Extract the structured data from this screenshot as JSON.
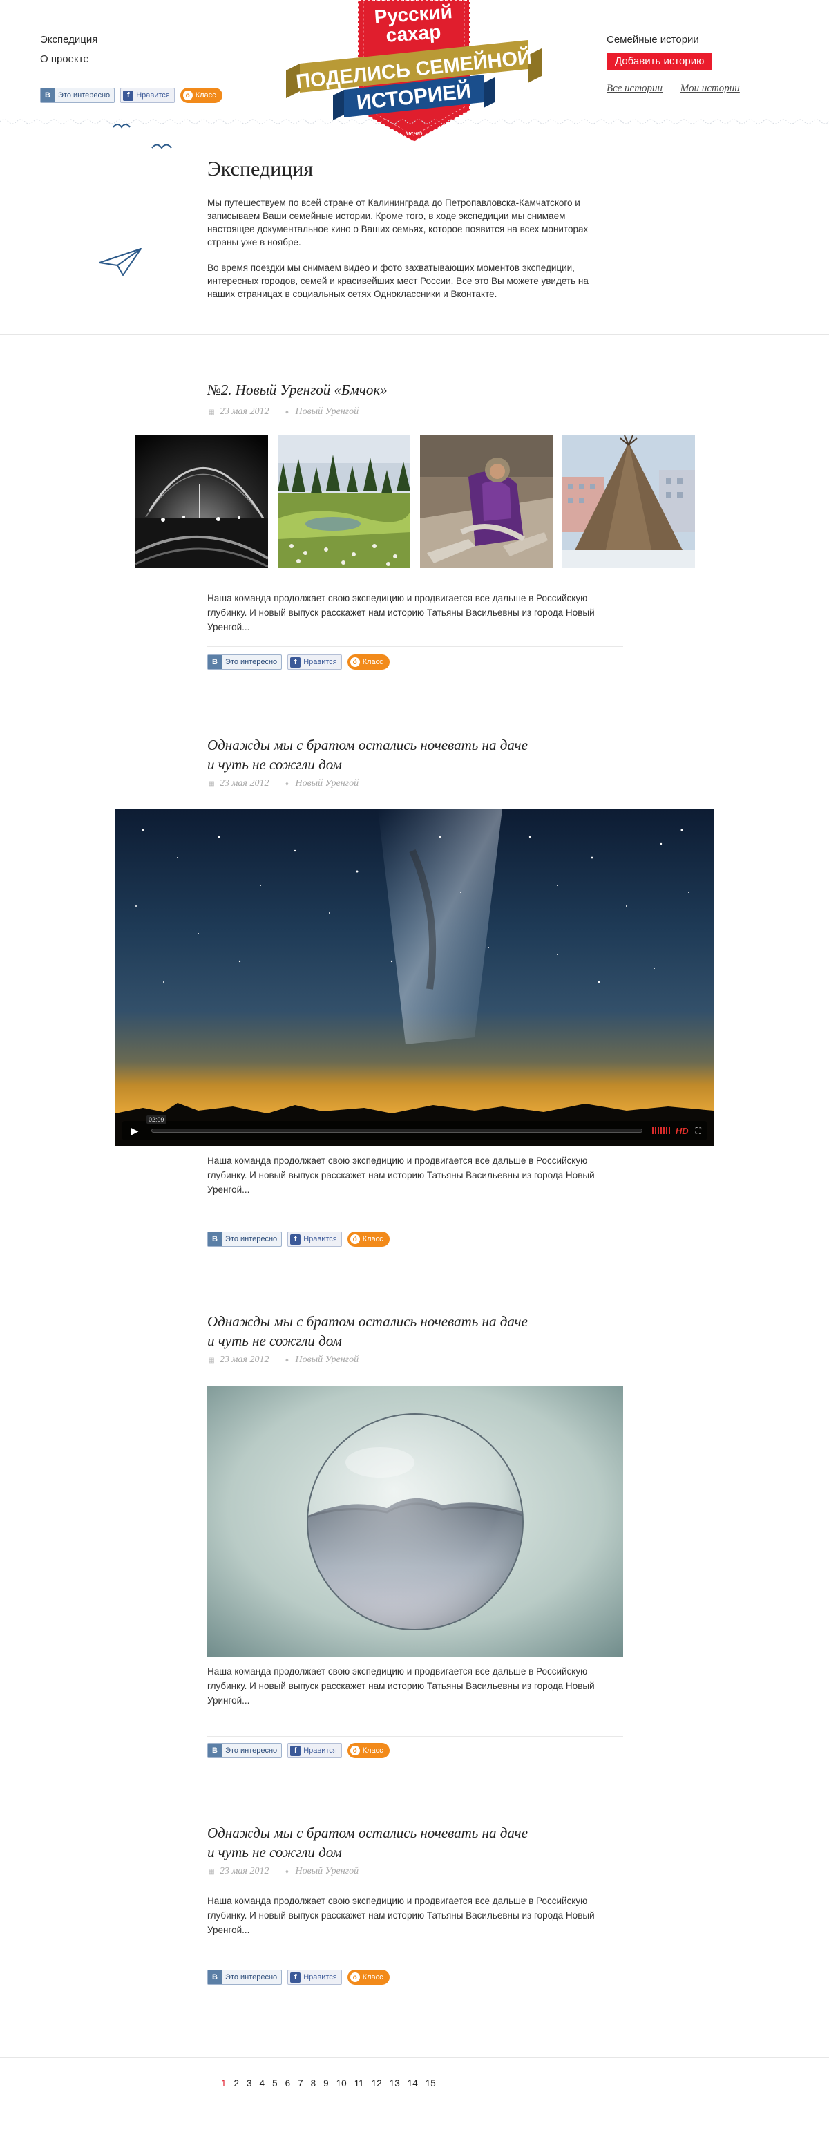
{
  "header": {
    "nav_left": [
      "Экспедиция",
      "О проекте"
    ],
    "nav_right_top": "Семейные истории",
    "add_story_button": "Добавить историю",
    "sub_links": [
      "Все истории",
      "Мои истории"
    ],
    "logo": {
      "brand_line1": "Русский",
      "brand_line2": "сахар",
      "slogan_line1": "ПОДЕЛИСЬ СЕМЕЙНОЙ",
      "slogan_line2": "ИСТОРИЕЙ",
      "menu_label": "меню"
    }
  },
  "share": {
    "vk_label": "Это интересно",
    "vk_logo": "В",
    "fb_label": "Нравится",
    "fb_logo": "f",
    "ok_label": "Класс",
    "ok_logo": "ö"
  },
  "intro": {
    "title": "Экспедиция",
    "paragraphs": [
      "Мы путешествуем по всей стране от Калининграда до Петропавловска-Камчатского и записываем Ваши семейные истории. Кроме того, в ходе экспедиции мы снимаем настоящее документальное кино о Ваших семьях, которое появится на всех мониторах страны уже в ноябре.",
      "Во время поездки мы снимаем видео и фото захватывающих моментов экспедиции, интересных городов, семей и красивейших мест России. Все это Вы можете увидеть на наших страницах в социальных сетях Одноклассники и Вконтакте."
    ]
  },
  "posts": [
    {
      "title": "№2. Новый Уренгой «Бмчок»",
      "date": "23 мая 2012",
      "place": "Новый Уренгой",
      "text": "Наша команда продолжает свою экспедицию и продвигается все дальше в Российскую глубинку. И новый выпуск расскажет нам историю Татьяны Васильевны из города Новый Уренгой..."
    },
    {
      "title_line1": "Однажды мы с братом остались ночевать на даче",
      "title_line2": "и чуть не сожгли дом",
      "date": "23 мая 2012",
      "place": "Новый Уренгой",
      "video_time": "02:09",
      "video_hd": "HD",
      "text": "Наша команда продолжает свою экспедицию и продвигается все дальше в Российскую глубинку. И новый выпуск расскажет нам историю Татьяны Васильевны из города Новый Уренгой..."
    },
    {
      "title_line1": "Однажды мы с братом остались ночевать на даче",
      "title_line2": "и чуть не сожгли дом",
      "date": "23 мая 2012",
      "place": "Новый Уренгой",
      "text": "Наша команда продолжает свою экспедицию и продвигается все дальше в Российскую глубинку. И новый выпуск расскажет нам историю Татьяны Васильевны из города Новый Урингой..."
    },
    {
      "title_line1": "Однажды мы с братом остались ночевать на даче",
      "title_line2": "и чуть не сожгли дом",
      "date": "23 мая 2012",
      "place": "Новый Уренгой",
      "text": "Наша команда продолжает свою экспедицию и продвигается все дальше в Российскую глубинку. И новый выпуск расскажет нам историю Татьяны Васильевны из города Новый Уренгой..."
    }
  ],
  "pagination": {
    "pages": [
      "1",
      "2",
      "3",
      "4",
      "5",
      "6",
      "7",
      "8",
      "9",
      "10",
      "11",
      "12",
      "13",
      "14",
      "15"
    ],
    "current": "1"
  },
  "colors": {
    "accent_red": "#ea1c2c",
    "logo_gold": "#b99a36",
    "logo_blue": "#1a4e8c",
    "ok_orange": "#f28a1a"
  },
  "icons": [
    "calendar-icon",
    "location-pin-icon",
    "play-icon",
    "fullscreen-icon",
    "paper-plane-icon",
    "bird-icon"
  ]
}
